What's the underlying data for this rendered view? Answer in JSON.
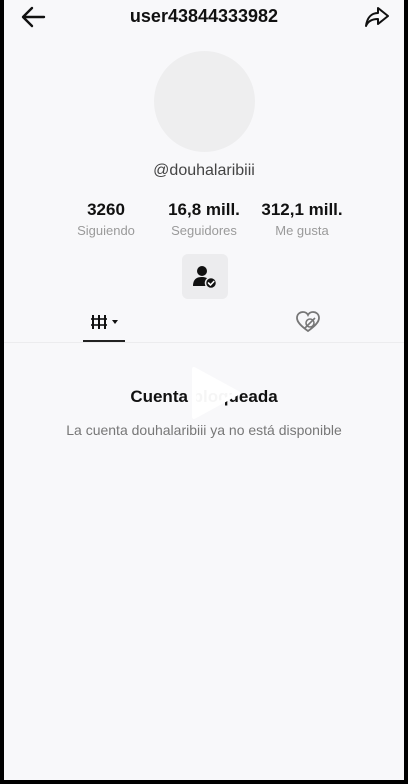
{
  "header": {
    "username": "user43844333982",
    "back_icon": "arrow-left-icon",
    "share_icon": "share-arrow-icon"
  },
  "profile": {
    "handle": "@douhalaribiii",
    "avatar": "empty-avatar"
  },
  "stats": [
    {
      "value": "3260",
      "label": "Siguiendo"
    },
    {
      "value": "16,8 mill.",
      "label": "Seguidores"
    },
    {
      "value": "312,1 mill.",
      "label": "Me gusta"
    }
  ],
  "follow_button": {
    "icon": "person-check-icon"
  },
  "tabs": {
    "videos_icon": "grid-bars-icon",
    "liked_icon": "hidden-heart-icon"
  },
  "blocked": {
    "title": "Cuenta bloqueada",
    "message": "La cuenta douhalaribiii ya no está disponible"
  },
  "colors": {
    "background": "#f8f8fa",
    "text_primary": "#111111",
    "text_secondary": "#9a9a9a",
    "avatar_bg": "#eeeeef",
    "button_bg": "#ececee"
  }
}
